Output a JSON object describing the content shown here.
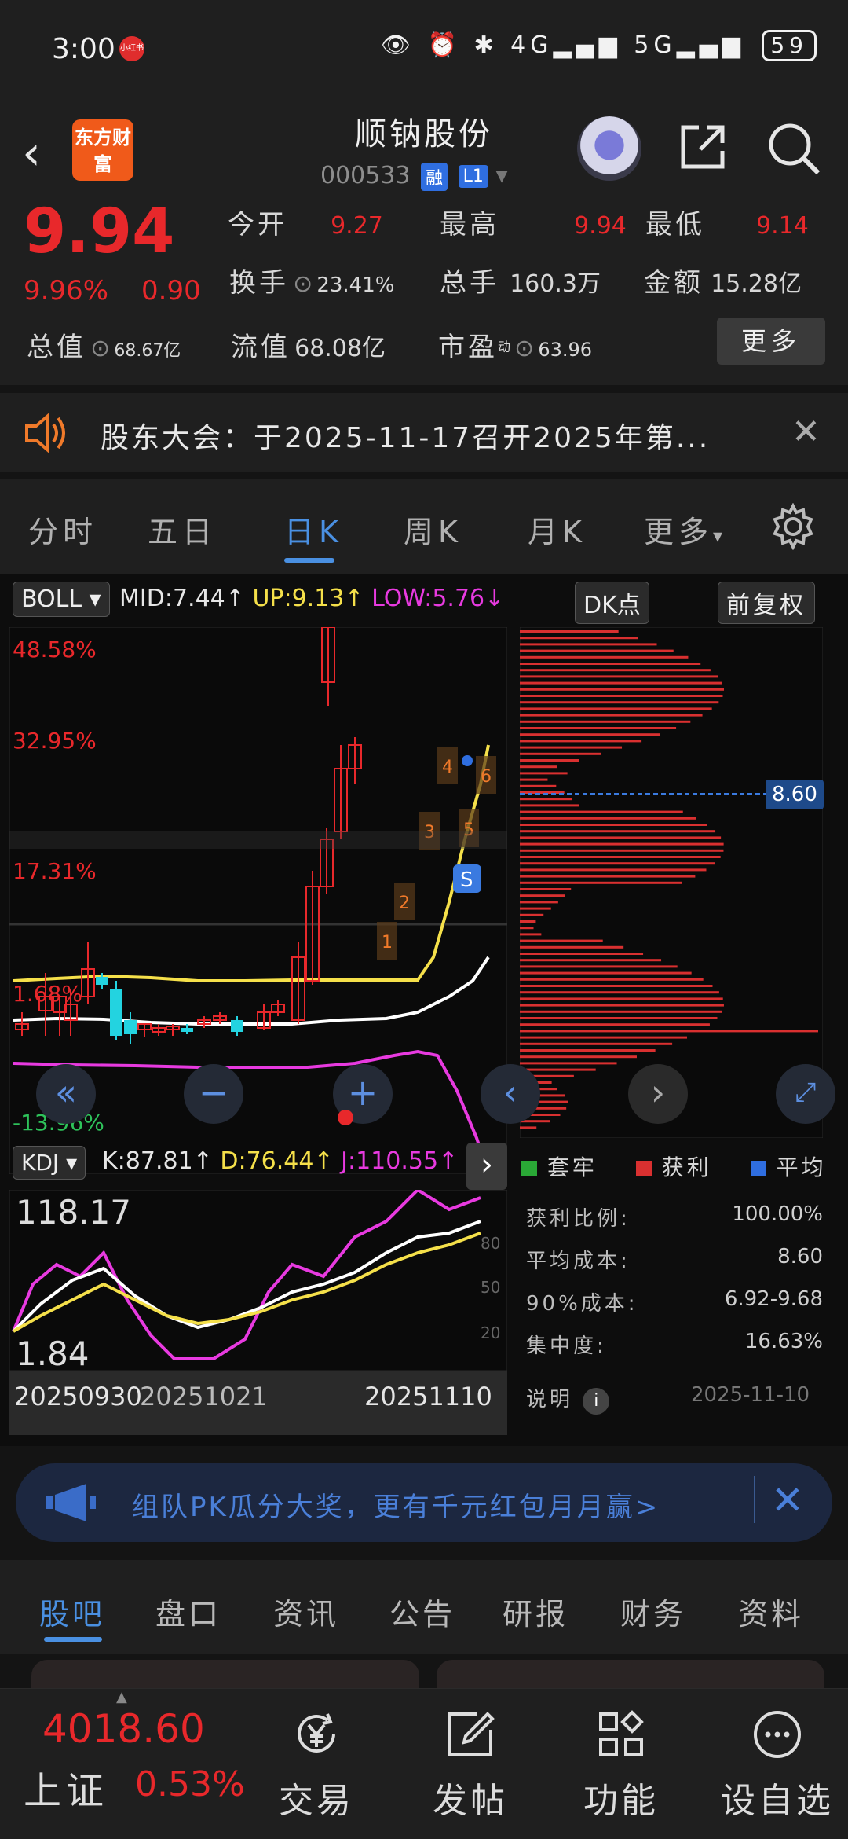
{
  "status_bar": {
    "time": "3:00",
    "badge": "小红书",
    "battery": "59",
    "signal_a": "4G",
    "signal_b": "5G"
  },
  "header": {
    "title": "顺钠股份",
    "code": "000533",
    "tag_rong": "融",
    "tag_l1": "L1",
    "logo": "东方财富"
  },
  "quote": {
    "price": "9.94",
    "change_pct": "9.96%",
    "change_amt": "0.90",
    "open_label": "今开",
    "open": "9.27",
    "high_label": "最高",
    "high": "9.94",
    "low_label": "最低",
    "low": "9.14",
    "turnover_label": "换手",
    "turnover": "23.41%",
    "volume_label": "总手",
    "volume": "160.3万",
    "amount_label": "金额",
    "amount": "15.28亿",
    "mktcap_label": "总值",
    "mktcap": "68.67亿",
    "float_label": "流值",
    "float": "68.08亿",
    "pe_label": "市盈",
    "pe_sup": "动",
    "pe": "63.96",
    "more": "更多"
  },
  "notice": {
    "text": "股东大会：于2025-11-17召开2025年第..."
  },
  "period_tabs": {
    "items": [
      "分时",
      "五日",
      "日K",
      "周K",
      "月K",
      "更多"
    ],
    "active": "日K"
  },
  "boll": {
    "label": "BOLL",
    "mid": "MID:7.44",
    "up": "UP:9.13",
    "low": "LOW:5.76",
    "dk": "DK点",
    "adjust": "前复权"
  },
  "price_axis": {
    "p1": "48.58%",
    "p2": "32.95%",
    "p3": "17.31%",
    "p4": "1.68%",
    "p5": "-13.96%"
  },
  "cost_line": "8.60",
  "kdj": {
    "label": "KDJ",
    "k": "K:87.81",
    "d": "D:76.44",
    "j": "J:110.55",
    "top": "118.17",
    "bottom": "1.84",
    "l80": "80",
    "l50": "50",
    "l20": "20"
  },
  "dates": {
    "d1": "20250930",
    "d2": "20251021",
    "d3": "20251110"
  },
  "legend": {
    "a": "套牢",
    "b": "获利",
    "c": "平均"
  },
  "stats": {
    "profit_ratio_label": "获利比例:",
    "profit_ratio": "100.00%",
    "avg_cost_label": "平均成本:",
    "avg_cost": "8.60",
    "cost90_label": "90%成本:",
    "cost90": "6.92-9.68",
    "concentration_label": "集中度:",
    "concentration": "16.63%",
    "explain_label": "说明",
    "date": "2025-11-10"
  },
  "promo": {
    "text": "组队PK瓜分大奖，更有千元红包月月赢>"
  },
  "bottom_tabs": {
    "items": [
      "股吧",
      "盘口",
      "资讯",
      "公告",
      "研报",
      "财务",
      "资料"
    ],
    "active": "股吧"
  },
  "index_ticker": {
    "value": "4018.60",
    "name": "上证",
    "change": "0.53%"
  },
  "bottom_nav": {
    "trade": "交易",
    "post": "发帖",
    "func": "功能",
    "watch": "设自选"
  }
}
